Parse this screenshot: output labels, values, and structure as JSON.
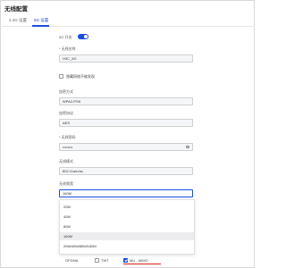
{
  "header": {
    "title": "无线配置"
  },
  "tabs": [
    {
      "label": "2.4G 设置"
    },
    {
      "label": "5G 设置",
      "active": true
    }
  ],
  "form": {
    "switch": {
      "label": "5G 开关",
      "on": true
    },
    "ssid": {
      "label": "无线名称",
      "value": "H3C_5G"
    },
    "hide_ssid": {
      "label": "隐藏网络不被发现",
      "checked": false
    },
    "security": {
      "label": "加密方式",
      "value": "WPA2-PSK"
    },
    "algorithm": {
      "label": "加密协议",
      "value": "AES"
    },
    "password": {
      "label": "无线密码",
      "value": "••••••••"
    },
    "mode": {
      "label": "无线模式",
      "value": "802.11a/n/ac"
    },
    "bandwidth": {
      "label": "无线频宽",
      "value": "160M"
    }
  },
  "dropdown": {
    "options": [
      {
        "label": "20M"
      },
      {
        "label": "40M"
      },
      {
        "label": "80M"
      },
      {
        "label": "160M",
        "selected": true
      },
      {
        "label": "20M/40M/80M/160M"
      }
    ]
  },
  "bottom_options": [
    {
      "label": "OFDMA",
      "checked": false
    },
    {
      "label": "TWT",
      "checked": false
    },
    {
      "label": "MU - MIMO",
      "checked": true
    }
  ],
  "colors": {
    "accent": "#1a4fd8",
    "required": "#e03030",
    "highlight_underline": "#d82020"
  }
}
